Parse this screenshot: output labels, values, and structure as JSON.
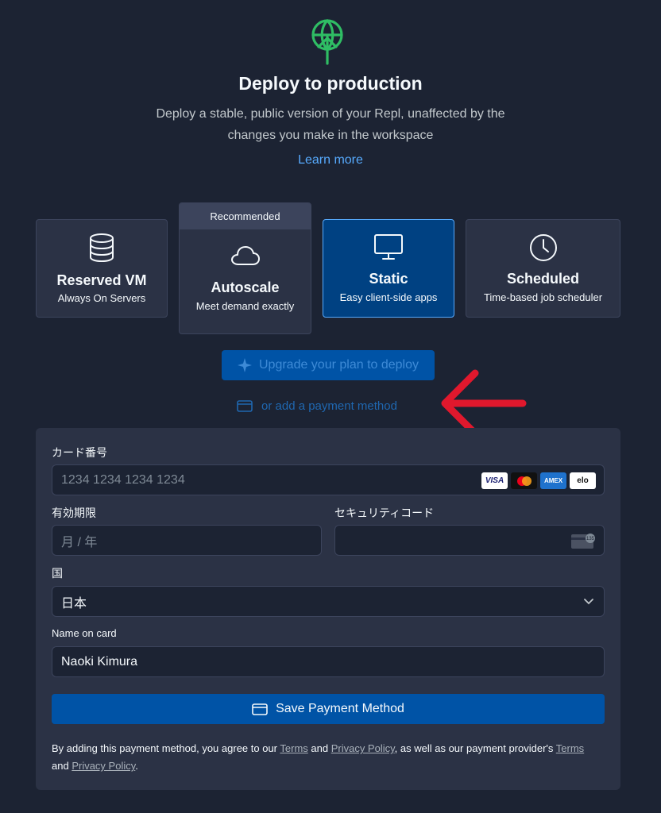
{
  "header": {
    "title": "Deploy to production",
    "subtitle": "Deploy a stable, public version of your Repl, unaffected by the changes you make in the workspace",
    "learn_more": "Learn more",
    "logo_icon": "globe-upload-icon"
  },
  "deploy_types": [
    {
      "name": "Reserved VM",
      "desc": "Always On Servers",
      "icon": "database-icon",
      "selected": false
    },
    {
      "name": "Autoscale",
      "desc": "Meet demand exactly",
      "icon": "cloud-icon",
      "badge": "Recommended",
      "selected": false
    },
    {
      "name": "Static",
      "desc": "Easy client-side apps",
      "icon": "monitor-icon",
      "selected": true
    },
    {
      "name": "Scheduled",
      "desc": "Time-based job scheduler",
      "icon": "clock-icon",
      "selected": false
    }
  ],
  "actions": {
    "upgrade_label": "Upgrade your plan to deploy",
    "add_payment_label": "or add a payment method"
  },
  "payment_form": {
    "card_number_label": "カード番号",
    "card_number_placeholder": "1234 1234 1234 1234",
    "card_brands": [
      "VISA",
      "Mastercard",
      "AMEX",
      "elo"
    ],
    "expiry_label": "有効期限",
    "expiry_placeholder": "月 / 年",
    "cvc_label": "セキュリティコード",
    "country_label": "国",
    "country_value": "日本",
    "name_label": "Name on card",
    "name_value": "Naoki Kimura",
    "save_label": "Save Payment Method",
    "legal": {
      "part1": "By adding this payment method, you agree to our ",
      "terms1": "Terms",
      "and1": " and ",
      "privacy1": "Privacy Policy",
      "part2": ", as well as our payment provider's ",
      "terms2": "Terms",
      "and2": " and ",
      "privacy2": "Privacy Policy",
      "end": "."
    }
  },
  "colors": {
    "background": "#1c2333",
    "card": "#2b3245",
    "selected_card": "#004182",
    "accent": "#0053a6",
    "link": "#57abff",
    "logo_green": "#2fbd64",
    "annotation_red": "#e0182d"
  }
}
